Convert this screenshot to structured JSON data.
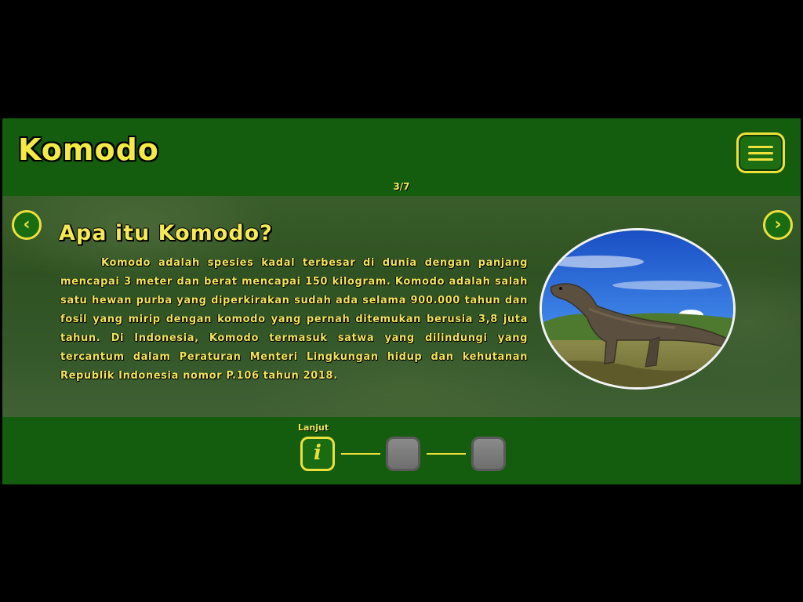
{
  "header": {
    "title": "Komodo",
    "menu_icon": "hamburger-menu-icon"
  },
  "pager": {
    "indicator": "3/7"
  },
  "content": {
    "heading": "Apa itu Komodo?",
    "paragraph": "Komodo adalah spesies kadal terbesar di dunia dengan panjang mencapai 3 meter dan berat mencapai 150 kilogram. Komodo adalah salah satu hewan purba yang diperkirakan sudah ada selama 900.000 tahun dan fosil yang mirip dengan komodo yang pernah ditemukan berusia 3,8 juta tahun. Di Indonesia, Komodo termasuk satwa yang dilindungi  yang tercantum dalam Peraturan Menteri Lingkungan hidup dan kehutanan Republik Indonesia nomor P.106 tahun 2018.",
    "image": "komodo-dragon-photo"
  },
  "nav": {
    "prev_icon": "chevron-left-icon",
    "next_icon": "chevron-right-icon",
    "prev_glyph": "‹",
    "next_glyph": "›"
  },
  "steps": {
    "label": "Lanjut",
    "active_glyph": "i",
    "items": [
      "info",
      "locked",
      "locked"
    ]
  },
  "colors": {
    "frame_green": "#155d0e",
    "accent_yellow": "#f4ea45"
  }
}
